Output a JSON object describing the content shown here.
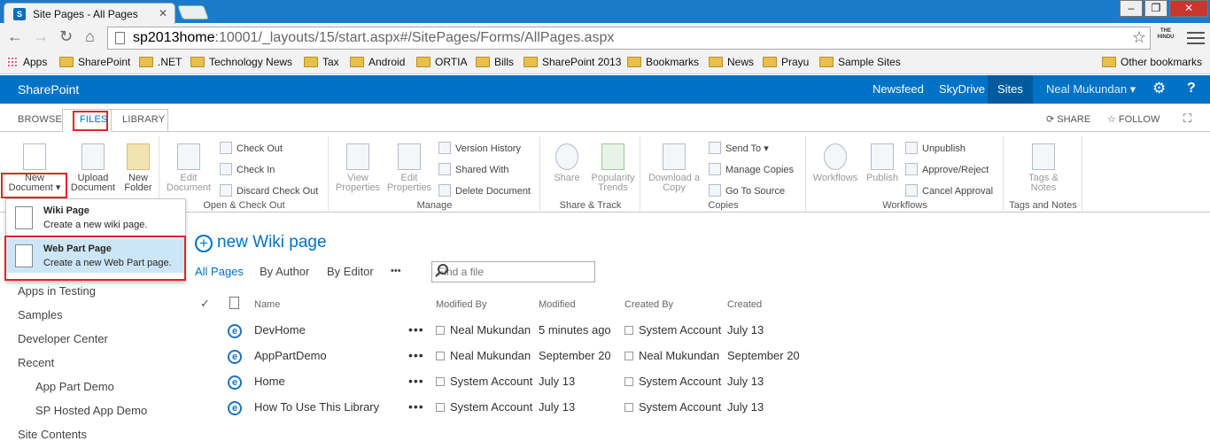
{
  "browser": {
    "tab_title": "Site Pages - All Pages",
    "tab_favicon": "S",
    "url_host": "sp2013home",
    "url_path": ":10001/_layouts/15/start.aspx#/SitePages/Forms/AllPages.aspx",
    "extension_label": "THE HINDU",
    "bookmarks": [
      "Apps",
      "SharePoint",
      ".NET",
      "Technology News",
      "Tax",
      "Android",
      "ORTIA",
      "Bills",
      "SharePoint 2013",
      "Bookmarks",
      "News",
      "Prayu",
      "Sample Sites"
    ],
    "other_bookmarks": "Other bookmarks"
  },
  "suitebar": {
    "brand": "SharePoint",
    "links": [
      "Newsfeed",
      "SkyDrive",
      "Sites"
    ],
    "user": "Neal Mukundan",
    "accent": "#0072c6"
  },
  "ribbon": {
    "tabs": [
      "BROWSE",
      "FILES",
      "LIBRARY"
    ],
    "share": "SHARE",
    "follow": "FOLLOW",
    "groups": {
      "new": {
        "new_document_1": "New",
        "new_document_2": "Document",
        "upload_1": "Upload",
        "upload_2": "Document",
        "folder_1": "New",
        "folder_2": "Folder"
      },
      "open": {
        "label": "Open & Check Out",
        "edit_1": "Edit",
        "edit_2": "Document",
        "check_out": "Check Out",
        "check_in": "Check In",
        "discard": "Discard Check Out"
      },
      "manage": {
        "label": "Manage",
        "view_1": "View",
        "view_2": "Properties",
        "editp_1": "Edit",
        "editp_2": "Properties",
        "version": "Version History",
        "shared": "Shared With",
        "delete": "Delete Document"
      },
      "share": {
        "label": "Share & Track",
        "share": "Share",
        "pop_1": "Popularity",
        "pop_2": "Trends"
      },
      "copies": {
        "label": "Copies",
        "download_1": "Download a",
        "download_2": "Copy",
        "send_to": "Send To",
        "manage_copies": "Manage Copies",
        "go_source": "Go To Source"
      },
      "workflows": {
        "label": "Workflows",
        "workflows": "Workflows",
        "publish": "Publish",
        "unpublish": "Unpublish",
        "approve": "Approve/Reject",
        "cancel": "Cancel Approval"
      },
      "tags": {
        "label": "Tags and Notes",
        "tags_1": "Tags &",
        "tags_2": "Notes"
      }
    }
  },
  "dropdown": {
    "items": [
      {
        "title": "Wiki Page",
        "desc": "Create a new wiki page."
      },
      {
        "title": "Web Part Page",
        "desc": "Create a new Web Part page."
      }
    ]
  },
  "leftnav": [
    "Apps in Testing",
    "Samples",
    "Developer Center",
    "Recent",
    "App Part Demo",
    "SP Hosted App Demo",
    "Site Contents"
  ],
  "main": {
    "new_page": "new Wiki page",
    "views": [
      "All Pages",
      "By Author",
      "By Editor"
    ],
    "ellipsis": "•••",
    "search_placeholder": "Find a file",
    "columns": [
      "Name",
      "Modified By",
      "Modified",
      "Created By",
      "Created"
    ],
    "rows": [
      {
        "name": "DevHome",
        "modified_by": "Neal Mukundan",
        "modified": "5 minutes ago",
        "created_by": "System Account",
        "created": "July 13"
      },
      {
        "name": "AppPartDemo",
        "modified_by": "Neal Mukundan",
        "modified": "September 20",
        "created_by": "Neal Mukundan",
        "created": "September 20"
      },
      {
        "name": "Home",
        "modified_by": "System Account",
        "modified": "July 13",
        "created_by": "System Account",
        "created": "July 13"
      },
      {
        "name": "How To Use This Library",
        "modified_by": "System Account",
        "modified": "July 13",
        "created_by": "System Account",
        "created": "July 13"
      }
    ]
  }
}
